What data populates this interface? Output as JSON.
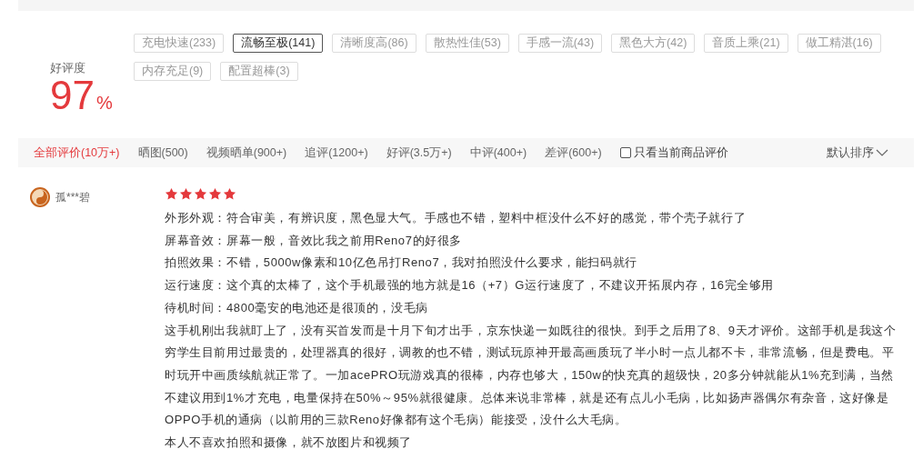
{
  "rating": {
    "label": "好评度",
    "value": "97",
    "unit": "%"
  },
  "tags": [
    {
      "label": "充电快速(233)",
      "selected": false
    },
    {
      "label": "流畅至极(141)",
      "selected": true
    },
    {
      "label": "清晰度高(86)",
      "selected": false
    },
    {
      "label": "散热性佳(53)",
      "selected": false
    },
    {
      "label": "手感一流(43)",
      "selected": false
    },
    {
      "label": "黑色大方(42)",
      "selected": false
    },
    {
      "label": "音质上乘(21)",
      "selected": false
    },
    {
      "label": "做工精湛(16)",
      "selected": false
    },
    {
      "label": "内存充足(9)",
      "selected": false
    },
    {
      "label": "配置超棒(3)",
      "selected": false
    }
  ],
  "filters": [
    {
      "label": "全部评价(10万+)",
      "selected": true
    },
    {
      "label": "晒图(500)",
      "selected": false
    },
    {
      "label": "视频晒单(900+)",
      "selected": false
    },
    {
      "label": "追评(1200+)",
      "selected": false
    },
    {
      "label": "好评(3.5万+)",
      "selected": false
    },
    {
      "label": "中评(400+)",
      "selected": false
    },
    {
      "label": "差评(600+)",
      "selected": false
    }
  ],
  "current_only": {
    "label": "只看当前商品评价",
    "checked": false
  },
  "sort": {
    "label": "默认排序"
  },
  "review": {
    "user": "孤***碧",
    "stars": 5,
    "paragraphs": [
      "外形外观：符合审美，有辨识度，黑色显大气。手感也不错，塑料中框没什么不好的感觉，带个壳子就行了",
      "屏幕音效：屏幕一般，音效比我之前用Reno7的好很多",
      "拍照效果：不错，5000w像素和10亿色吊打Reno7，我对拍照没什么要求，能扫码就行",
      "运行速度：这个真的太棒了，这个手机最强的地方就是16（+7）G运行速度了，不建议开拓展内存，16完全够用",
      "待机时间：4800毫安的电池还是很顶的，没毛病",
      "这手机刚出我就盯上了，没有买首发而是十月下旬才出手，京东快递一如既往的很快。到手之后用了8、9天才评价。这部手机是我这个穷学生目前用过最贵的，处理器真的很好，调教的也不错，测试玩原神开最高画质玩了半小时一点儿都不卡，非常流畅，但是费电。平时玩开中画质续航就正常了。一加acePRO玩游戏真的很棒，内存也够大，150w的快充真的超级快，20多分钟就能从1%充到满，当然不建议用到1%才充电，电量保持在50%～95%就很健康。总体来说非常棒，就是还有点儿小毛病，比如扬声器偶尔有杂音，这好像是OPPO手机的通病（以前用的三款Reno好像都有这个毛病）能接受，没什么大毛病。",
      "本人不喜欢拍照和摄像，就不放图片和视频了"
    ]
  }
}
